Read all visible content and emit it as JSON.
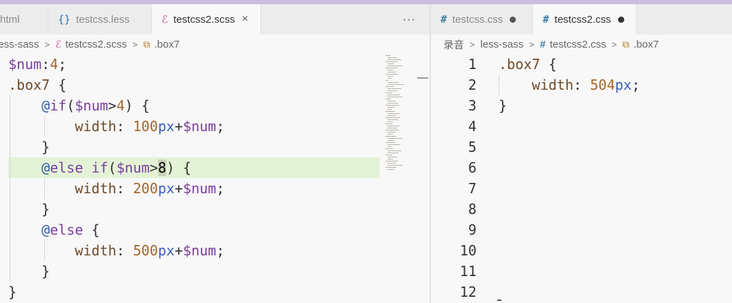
{
  "left_tabs": [
    {
      "label": "html",
      "state": "inactive"
    },
    {
      "label": "testcss.less",
      "state": "inactive",
      "icon": "less-braces-icon"
    },
    {
      "label": "testcss2.scss",
      "state": "active",
      "icon": "sass-icon"
    }
  ],
  "right_tabs": [
    {
      "label": "testcss.css",
      "state": "modified",
      "icon": "css-hash-icon"
    },
    {
      "label": "testcss2.css",
      "state": "active-modified",
      "icon": "css-hash-icon"
    }
  ],
  "more_actions": "···",
  "close_glyph": "×",
  "left_breadcrumb": {
    "folder": "less-sass",
    "file": "testcss2.scss",
    "symbol": ".box7"
  },
  "right_breadcrumb": {
    "root": "录音",
    "folder": "less-sass",
    "file": "testcss2.css",
    "symbol": ".box7"
  },
  "scss_code": [
    [
      [
        "t-var",
        "$num"
      ],
      [
        "t-pl",
        ":"
      ],
      [
        "t-num",
        "4"
      ],
      [
        "t-pl",
        ";"
      ]
    ],
    [
      [
        "t-sel",
        ".box7"
      ],
      [
        "t-pl",
        " {"
      ]
    ],
    [
      [
        "t-pl",
        "    "
      ],
      [
        "t-at",
        "@"
      ],
      [
        "t-kw",
        "if"
      ],
      [
        "t-pl",
        "("
      ],
      [
        "t-var",
        "$num"
      ],
      [
        "t-pl",
        ">"
      ],
      [
        "t-num",
        "4"
      ],
      [
        "t-pl",
        ") {"
      ]
    ],
    [
      [
        "t-pl",
        "        "
      ],
      [
        "t-prop",
        "width"
      ],
      [
        "t-pl",
        ": "
      ],
      [
        "t-num",
        "100"
      ],
      [
        "t-unit",
        "px"
      ],
      [
        "t-pl",
        "+"
      ],
      [
        "t-var",
        "$num"
      ],
      [
        "t-pl",
        ";"
      ]
    ],
    [
      [
        "t-pl",
        "    }"
      ]
    ],
    [
      [
        "t-pl",
        "    "
      ],
      [
        "t-at",
        "@"
      ],
      [
        "t-kw",
        "else if"
      ],
      [
        "t-pl",
        "("
      ],
      [
        "t-var",
        "$num"
      ],
      [
        "t-pl",
        ">"
      ],
      [
        "match",
        "8"
      ],
      [
        "t-pl",
        ") {"
      ]
    ],
    [
      [
        "t-pl",
        "        "
      ],
      [
        "t-prop",
        "width"
      ],
      [
        "t-pl",
        ": "
      ],
      [
        "t-num",
        "200"
      ],
      [
        "t-unit",
        "px"
      ],
      [
        "t-pl",
        "+"
      ],
      [
        "t-var",
        "$num"
      ],
      [
        "t-pl",
        ";"
      ]
    ],
    [
      [
        "t-pl",
        "    }"
      ]
    ],
    [
      [
        "t-pl",
        "    "
      ],
      [
        "t-at",
        "@"
      ],
      [
        "t-kw",
        "else"
      ],
      [
        "t-pl",
        " {"
      ]
    ],
    [
      [
        "t-pl",
        "        "
      ],
      [
        "t-prop",
        "width"
      ],
      [
        "t-pl",
        ": "
      ],
      [
        "t-num",
        "500"
      ],
      [
        "t-unit",
        "px"
      ],
      [
        "t-pl",
        "+"
      ],
      [
        "t-var",
        "$num"
      ],
      [
        "t-pl",
        ";"
      ]
    ],
    [
      [
        "t-pl",
        "    }"
      ]
    ],
    [
      [
        "t-pl",
        "}"
      ]
    ]
  ],
  "css_line_numbers": [
    "1",
    "2",
    "3",
    "4",
    "5",
    "6",
    "7",
    "8",
    "9",
    "10",
    "11",
    "12"
  ],
  "css_code": [
    [
      [
        "t-sel",
        ".box7"
      ],
      [
        "t-pl",
        " {"
      ]
    ],
    [
      [
        "t-pl",
        "    "
      ],
      [
        "t-prop",
        "width"
      ],
      [
        "t-pl",
        ": "
      ],
      [
        "t-num",
        "504"
      ],
      [
        "t-unit",
        "px"
      ],
      [
        "t-pl",
        ";"
      ]
    ],
    [
      [
        "t-pl",
        "}"
      ]
    ]
  ],
  "colors": {
    "active_line_highlight": "#e4f3d7",
    "title_strip": "#c9bde0",
    "sass_pink": "#c6538c",
    "css_blue": "#3f7ea6"
  }
}
